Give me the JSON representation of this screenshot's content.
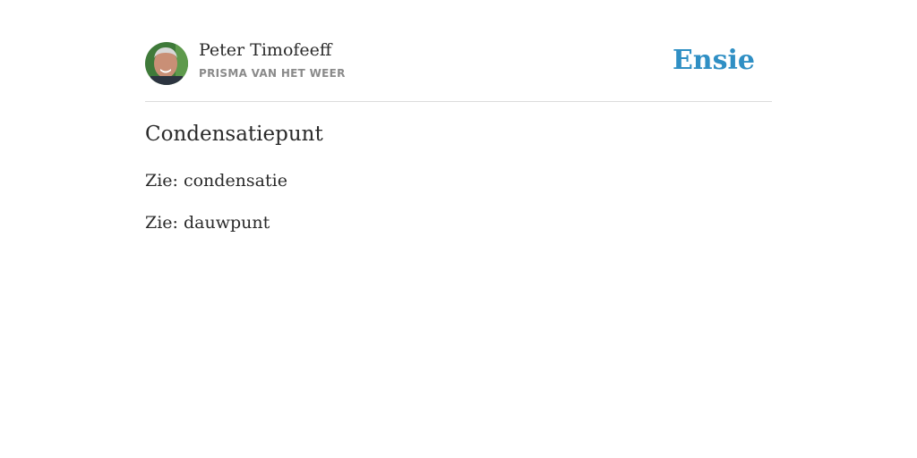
{
  "author": {
    "name": "Peter Timofeeff",
    "book": "PRISMA VAN HET WEER"
  },
  "brand": "Ensie",
  "entry": {
    "term": "Condensatiepunt",
    "references": [
      "Zie: condensatie",
      "Zie: dauwpunt"
    ]
  },
  "colors": {
    "brand": "#2f8fc4",
    "text": "#2a2a2a",
    "muted": "#8a8a8a",
    "divider": "#dcdcdc"
  }
}
